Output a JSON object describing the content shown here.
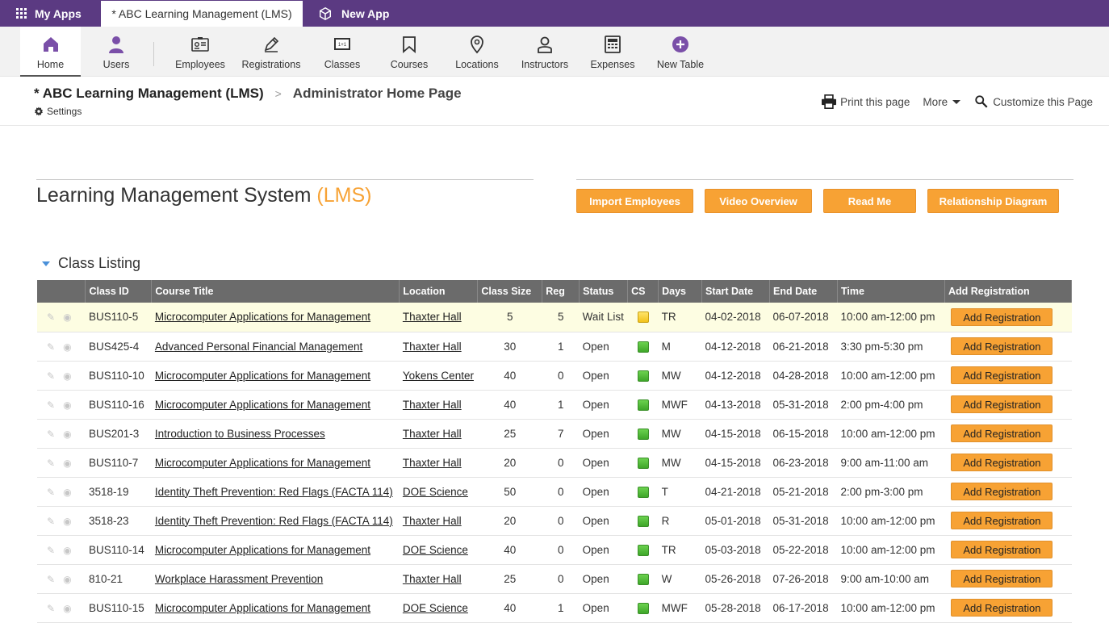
{
  "appbar": {
    "my_apps": "My Apps",
    "active_tab": "* ABC Learning Management (LMS)",
    "new_app": "New App"
  },
  "nav": {
    "home": "Home",
    "users": "Users",
    "employees": "Employees",
    "registrations": "Registrations",
    "classes": "Classes",
    "courses": "Courses",
    "locations": "Locations",
    "instructors": "Instructors",
    "expenses": "Expenses",
    "new_table": "New Table"
  },
  "header": {
    "app_name": "* ABC Learning Management (LMS)",
    "page_name": "Administrator Home Page",
    "settings": "Settings",
    "print": "Print this page",
    "more": "More",
    "customize": "Customize this Page"
  },
  "main": {
    "title": "Learning Management System",
    "title_accent": "(LMS)",
    "buttons": {
      "import": "Import Employees",
      "video": "Video Overview",
      "readme": "Read Me",
      "diagram": "Relationship Diagram"
    },
    "section_title": "Class Listing"
  },
  "table": {
    "headers": {
      "class_id": "Class ID",
      "course_title": "Course Title",
      "location": "Location",
      "class_size": "Class Size",
      "reg": "Reg",
      "status": "Status",
      "cs": "CS",
      "days": "Days",
      "start_date": "Start Date",
      "end_date": "End Date",
      "time": "Time",
      "add_registration": "Add Registration"
    },
    "add_label": "Add Registration",
    "rows": [
      {
        "id": "BUS110-5",
        "title": "Microcomputer Applications for Management",
        "loc": "Thaxter Hall",
        "size": "5",
        "reg": "5",
        "status": "Wait List",
        "cs": "yellow",
        "days": "TR",
        "start": "04-02-2018",
        "end": "06-07-2018",
        "time": "10:00 am-12:00 pm"
      },
      {
        "id": "BUS425-4",
        "title": "Advanced Personal Financial Management",
        "loc": "Thaxter Hall",
        "size": "30",
        "reg": "1",
        "status": "Open",
        "cs": "green",
        "days": "M",
        "start": "04-12-2018",
        "end": "06-21-2018",
        "time": "3:30 pm-5:30 pm"
      },
      {
        "id": "BUS110-10",
        "title": "Microcomputer Applications for Management",
        "loc": "Yokens Center",
        "size": "40",
        "reg": "0",
        "status": "Open",
        "cs": "green",
        "days": "MW",
        "start": "04-12-2018",
        "end": "04-28-2018",
        "time": "10:00 am-12:00 pm"
      },
      {
        "id": "BUS110-16",
        "title": "Microcomputer Applications for Management",
        "loc": "Thaxter Hall",
        "size": "40",
        "reg": "1",
        "status": "Open",
        "cs": "green",
        "days": "MWF",
        "start": "04-13-2018",
        "end": "05-31-2018",
        "time": "2:00 pm-4:00 pm"
      },
      {
        "id": "BUS201-3",
        "title": "Introduction to Business Processes",
        "loc": "Thaxter Hall",
        "size": "25",
        "reg": "7",
        "status": "Open",
        "cs": "green",
        "days": "MW",
        "start": "04-15-2018",
        "end": "06-15-2018",
        "time": "10:00 am-12:00 pm"
      },
      {
        "id": "BUS110-7",
        "title": "Microcomputer Applications for Management",
        "loc": "Thaxter Hall",
        "size": "20",
        "reg": "0",
        "status": "Open",
        "cs": "green",
        "days": "MW",
        "start": "04-15-2018",
        "end": "06-23-2018",
        "time": "9:00 am-11:00 am"
      },
      {
        "id": "3518-19",
        "title": "Identity Theft Prevention: Red Flags (FACTA 114)",
        "loc": "DOE Science",
        "size": "50",
        "reg": "0",
        "status": "Open",
        "cs": "green",
        "days": "T",
        "start": "04-21-2018",
        "end": "05-21-2018",
        "time": "2:00 pm-3:00 pm"
      },
      {
        "id": "3518-23",
        "title": "Identity Theft Prevention: Red Flags (FACTA 114)",
        "loc": "Thaxter Hall",
        "size": "20",
        "reg": "0",
        "status": "Open",
        "cs": "green",
        "days": "R",
        "start": "05-01-2018",
        "end": "05-31-2018",
        "time": "10:00 am-12:00 pm"
      },
      {
        "id": "BUS110-14",
        "title": "Microcomputer Applications for Management",
        "loc": "DOE Science",
        "size": "40",
        "reg": "0",
        "status": "Open",
        "cs": "green",
        "days": "TR",
        "start": "05-03-2018",
        "end": "05-22-2018",
        "time": "10:00 am-12:00 pm"
      },
      {
        "id": "810-21",
        "title": "Workplace Harassment Prevention",
        "loc": "Thaxter Hall",
        "size": "25",
        "reg": "0",
        "status": "Open",
        "cs": "green",
        "days": "W",
        "start": "05-26-2018",
        "end": "07-26-2018",
        "time": "9:00 am-10:00 am"
      },
      {
        "id": "BUS110-15",
        "title": "Microcomputer Applications for Management",
        "loc": "DOE Science",
        "size": "40",
        "reg": "1",
        "status": "Open",
        "cs": "green",
        "days": "MWF",
        "start": "05-28-2018",
        "end": "06-17-2018",
        "time": "10:00 am-12:00 pm"
      }
    ]
  }
}
